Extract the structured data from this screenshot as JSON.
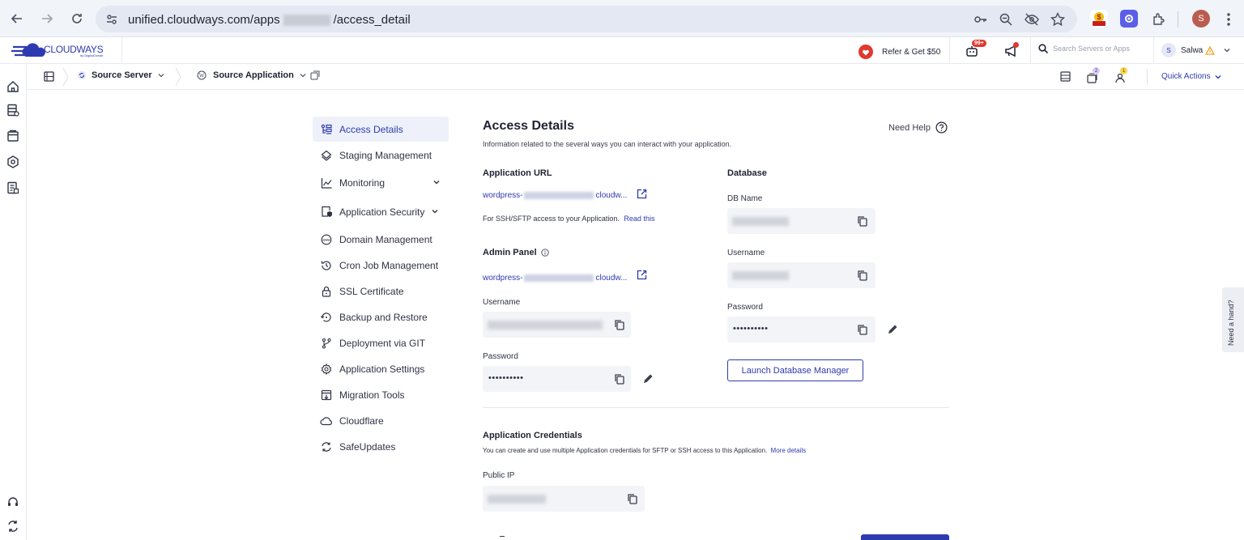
{
  "browser": {
    "url_prefix": "unified.cloudways.com/apps",
    "url_suffix": "/access_detail",
    "ext_badge": "SEO",
    "profile_initial": "S"
  },
  "header": {
    "logo_text": "CLOUDWAYS",
    "logo_sub": "by DigitalOcean",
    "refer_label": "Refer & Get $50",
    "notif_badge": "99+",
    "search_placeholder": "Search Servers or Apps",
    "user_initial": "S",
    "user_name": "Salwa"
  },
  "breadcrumb": {
    "server_label": "Source Server",
    "app_label": "Source Application",
    "badge_1": "2",
    "badge_2": "1",
    "quick_actions": "Quick Actions"
  },
  "sidebar": {
    "items": [
      {
        "label": "Access Details",
        "icon": "access-details-icon"
      },
      {
        "label": "Staging Management",
        "icon": "layers-icon"
      },
      {
        "label": "Monitoring",
        "icon": "chart-icon"
      },
      {
        "label": "Application Security",
        "icon": "shield-file-icon"
      },
      {
        "label": "Domain Management",
        "icon": "www-icon"
      },
      {
        "label": "Cron Job Management",
        "icon": "history-icon"
      },
      {
        "label": "SSL Certificate",
        "icon": "lock-icon"
      },
      {
        "label": "Backup and Restore",
        "icon": "restore-icon"
      },
      {
        "label": "Deployment via GIT",
        "icon": "git-branch-icon"
      },
      {
        "label": "Application Settings",
        "icon": "gear-icon"
      },
      {
        "label": "Migration Tools",
        "icon": "migration-icon"
      },
      {
        "label": "Cloudflare",
        "icon": "cloud-icon"
      },
      {
        "label": "SafeUpdates",
        "icon": "refresh-icon"
      }
    ]
  },
  "main": {
    "title": "Access Details",
    "subtitle": "Information related to the several ways you can interact with your application.",
    "help_label": "Need Help",
    "app_url_heading": "Application URL",
    "app_url_prefix": "wordpress-",
    "app_url_suffix": "cloudw...",
    "ssh_note": "For SSH/SFTP access to your Application.",
    "read_this": "Read this",
    "admin_heading": "Admin Panel",
    "admin_url_prefix": "wordpress-",
    "admin_url_suffix": "cloudw...",
    "username_label": "Username",
    "password_label": "Password",
    "password_value": "••••••••••",
    "db_heading": "Database",
    "db_name_label": "DB Name",
    "db_username_label": "Username",
    "db_password_label": "Password",
    "db_password_value": "••••••••••",
    "launch_db": "Launch Database Manager",
    "creds_heading": "Application Credentials",
    "creds_desc": "You can create and use multiple Application credentials for SFTP or SSH access to this Application.",
    "more_details": "More details",
    "public_ip_label": "Public IP"
  },
  "side_tab": "Need a hand?"
}
